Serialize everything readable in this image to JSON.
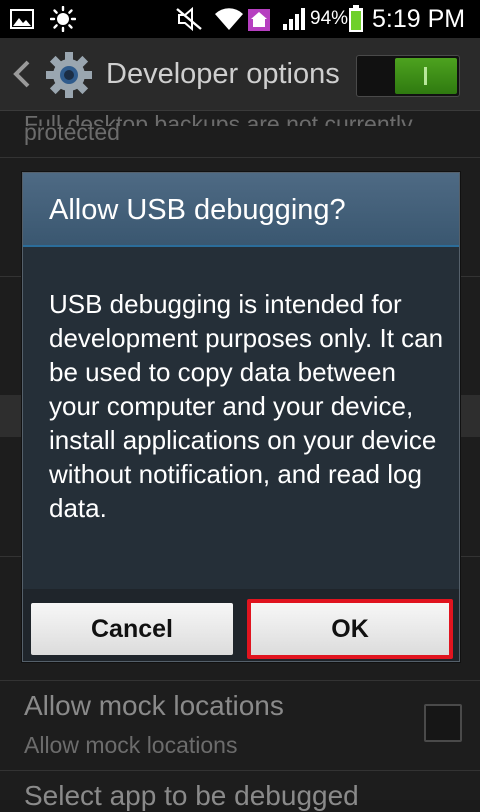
{
  "status_bar": {
    "battery_percent": "94%",
    "time": "5:19 PM"
  },
  "action_bar": {
    "title": "Developer options",
    "switch_state": "on"
  },
  "background_list": {
    "top_partial_line1": "Full desktop backups are not currently",
    "top_partial_line2": "protected",
    "mock_title": "Allow mock locations",
    "mock_summary": "Allow mock locations",
    "bottom_partial": "Select app to be debugged"
  },
  "dialog": {
    "title": "Allow USB debugging?",
    "body": "USB debugging is intended for development purposes only. It can be used to copy data between your computer and your device, install applications on your device without notification, and read log data.",
    "cancel_label": "Cancel",
    "ok_label": "OK"
  },
  "colors": {
    "accent_green": "#3a8f16",
    "highlight_red": "#e0141f",
    "dialog_title_bg": "#4e6a84"
  }
}
